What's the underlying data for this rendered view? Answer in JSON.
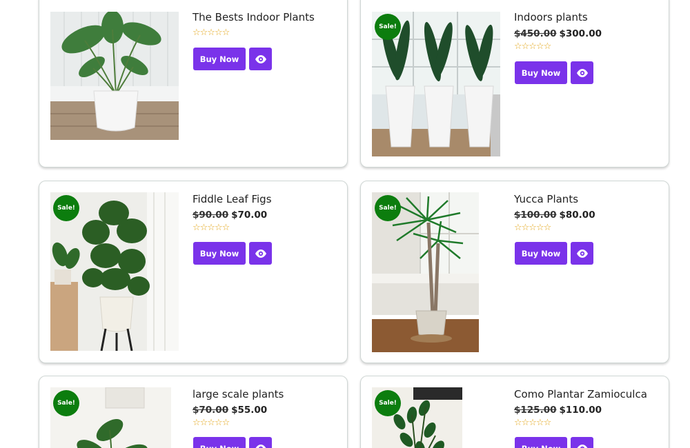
{
  "products": [
    {
      "title": "The Bests Indoor Plants",
      "old_price": "",
      "price": "",
      "sale": "",
      "stars": "☆☆☆☆☆",
      "buy": "Buy Now"
    },
    {
      "title": "Indoors plants",
      "old_price": "$450.00",
      "price": "$300.00",
      "sale": "Sale!",
      "stars": "☆☆☆☆☆",
      "buy": "Buy Now"
    },
    {
      "title": "Fiddle Leaf Figs",
      "old_price": "$90.00",
      "price": "$70.00",
      "sale": "Sale!",
      "stars": "☆☆☆☆☆",
      "buy": "Buy Now"
    },
    {
      "title": "Yucca Plants",
      "old_price": "$100.00",
      "price": "$80.00",
      "sale": "Sale!",
      "stars": "☆☆☆☆☆",
      "buy": "Buy Now"
    },
    {
      "title": "large scale plants",
      "old_price": "$70.00",
      "price": "$55.00",
      "sale": "Sale!",
      "stars": "☆☆☆☆☆",
      "buy": "Buy Now"
    },
    {
      "title": "Como Plantar Zamioculca",
      "old_price": "$125.00",
      "price": "$110.00",
      "sale": "Sale!",
      "stars": "☆☆☆☆☆",
      "buy": "Buy Now"
    }
  ],
  "colors": {
    "accent": "#7a33ea",
    "sale_badge": "#0c7d0e",
    "star": "#e3a619"
  },
  "icons": {
    "quick_view": "eye-icon",
    "rating": "star-icon"
  }
}
